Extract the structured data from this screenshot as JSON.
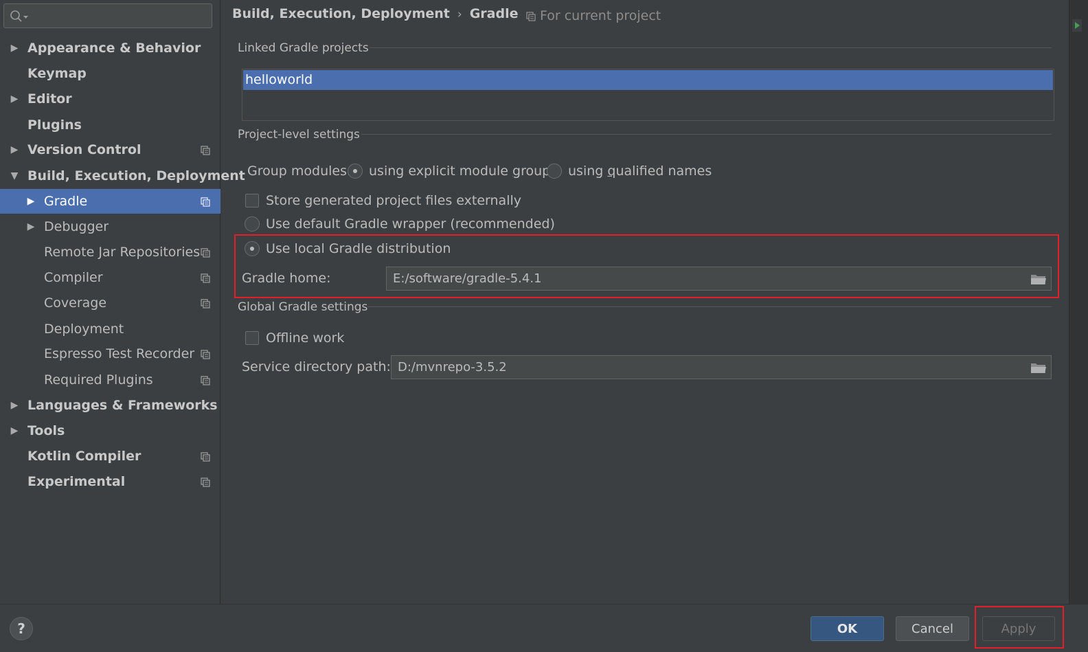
{
  "search": {
    "placeholder": ""
  },
  "sidebar": {
    "items": [
      {
        "label": "Appearance & Behavior"
      },
      {
        "label": "Keymap"
      },
      {
        "label": "Editor"
      },
      {
        "label": "Plugins"
      },
      {
        "label": "Version Control"
      },
      {
        "label": "Build, Execution, Deployment"
      },
      {
        "label": "Gradle"
      },
      {
        "label": "Debugger"
      },
      {
        "label": "Remote Jar Repositories"
      },
      {
        "label": "Compiler"
      },
      {
        "label": "Coverage"
      },
      {
        "label": "Deployment"
      },
      {
        "label": "Espresso Test Recorder"
      },
      {
        "label": "Required Plugins"
      },
      {
        "label": "Languages & Frameworks"
      },
      {
        "label": "Tools"
      },
      {
        "label": "Kotlin Compiler"
      },
      {
        "label": "Experimental"
      }
    ]
  },
  "breadcrumb": {
    "parent": "Build, Execution, Deployment",
    "separator": "›",
    "current": "Gradle"
  },
  "scope": {
    "label": "For current project"
  },
  "linked": {
    "title": "Linked Gradle projects",
    "projects": [
      "helloworld"
    ]
  },
  "project_settings": {
    "title": "Project-level settings",
    "group_modules_label": "Group modules:",
    "option_explicit_pre": "using explicit module ",
    "option_explicit_u": "g",
    "option_explicit_post": "roups",
    "option_qualified_pre": "using ",
    "option_qualified_u": "q",
    "option_qualified_post": "ualified names",
    "store_externally": "Store generated project files externally",
    "default_wrapper": "Use default Gradle wrapper (recommended)",
    "local_distribution": "Use local Gradle distribution",
    "gradle_home_label": "Gradle home:",
    "gradle_home_value": "E:/software/gradle-5.4.1"
  },
  "global_settings": {
    "title": "Global Gradle settings",
    "offline_work": "Offline work",
    "service_dir_label": "Service directory path:",
    "service_dir_value": "D:/mvnrepo-3.5.2"
  },
  "buttons": {
    "help": "?",
    "ok": "OK",
    "cancel": "Cancel",
    "apply": "Apply"
  },
  "colors": {
    "selection": "#4b6eaf",
    "highlight_box": "#e0202a",
    "background": "#3c3f41"
  }
}
